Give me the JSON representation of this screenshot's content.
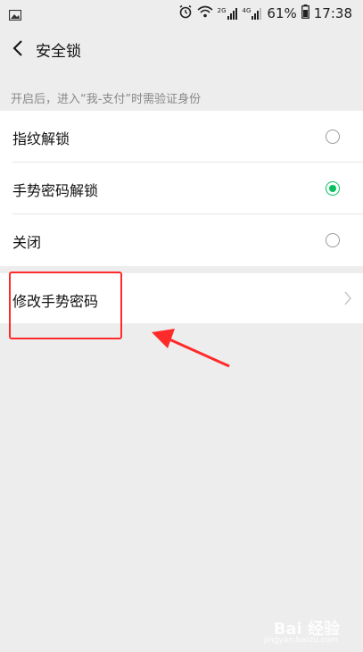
{
  "status_bar": {
    "battery": "61%",
    "time": "17:38",
    "gallery_icon": "image-icon",
    "alarm_icon": "alarm-icon",
    "wifi_icon": "wifi-icon",
    "signal_label_1": "2G",
    "signal_label_2": "4G"
  },
  "header": {
    "title": "安全锁"
  },
  "hint": "开启后，进入“我-支付”时需验证身份",
  "options": [
    {
      "label": "指纹解锁",
      "selected": false
    },
    {
      "label": "手势密码解锁",
      "selected": true
    },
    {
      "label": "关闭",
      "selected": false
    }
  ],
  "modify": {
    "label": "修改手势密码"
  },
  "colors": {
    "accent": "#07c160",
    "highlight": "#ff2a2a"
  },
  "watermark": {
    "brand": "Bai 经验",
    "url": "jingyan.baidu.com"
  }
}
